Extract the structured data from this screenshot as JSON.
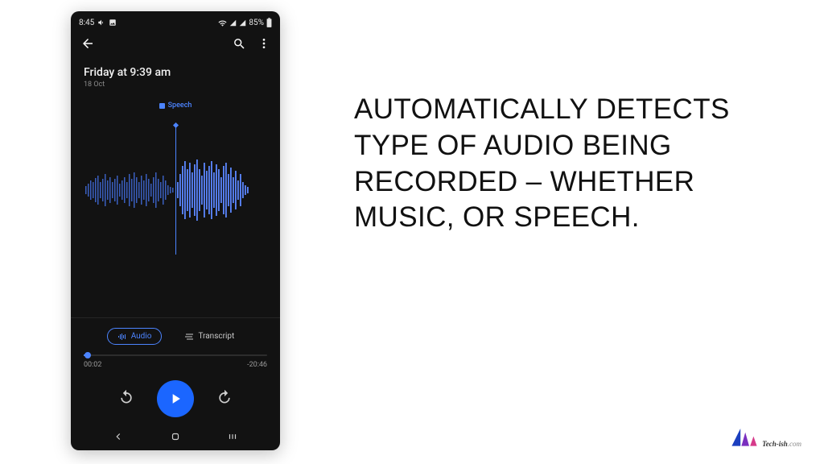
{
  "status": {
    "time": "8:45",
    "battery": "85%"
  },
  "recording": {
    "title": "Friday at 9:39 am",
    "date": "18 Oct",
    "detected": "Speech"
  },
  "tabs": {
    "audio": "Audio",
    "transcript": "Transcript"
  },
  "time": {
    "elapsed": "00:02",
    "remaining": "-20:46"
  },
  "headline": "Automatically detects type of audio being recorded – whether music, or speech.",
  "brand": "Tech-ish",
  "brand_suffix": ".com"
}
